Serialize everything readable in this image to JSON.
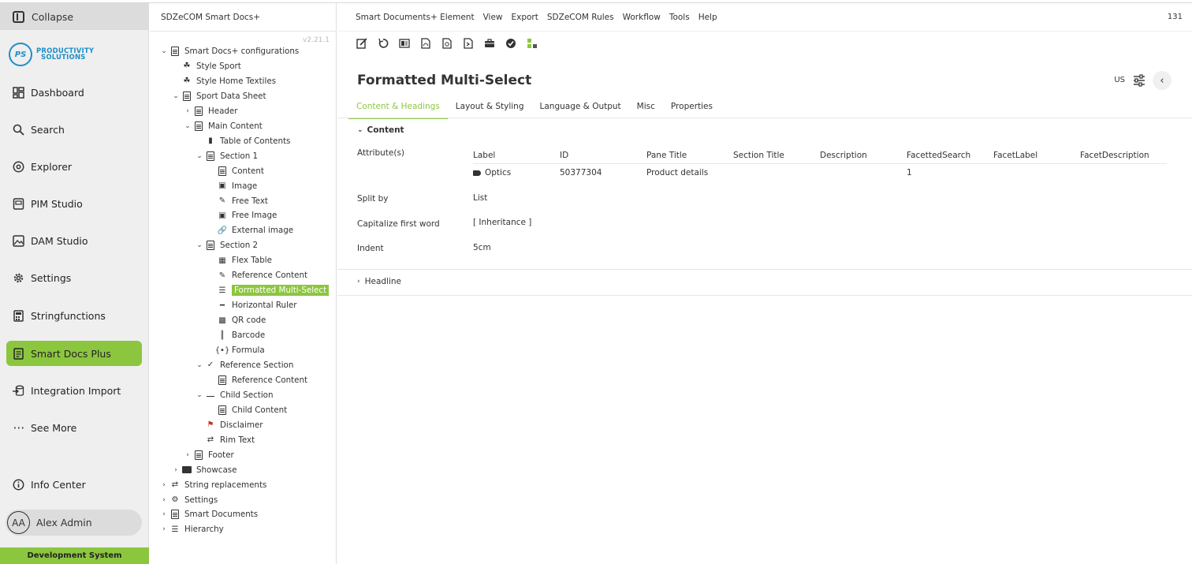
{
  "sidebar": {
    "collapse_label": "Collapse",
    "logo_initials": "PS",
    "logo_line1": "PRODUCTIVITY",
    "logo_line2": "SOLUTIONS",
    "items": [
      {
        "label": "Dashboard",
        "icon": "dashboard-icon"
      },
      {
        "label": "Search",
        "icon": "search-icon"
      },
      {
        "label": "Explorer",
        "icon": "explorer-icon"
      },
      {
        "label": "PIM Studio",
        "icon": "pim-icon"
      },
      {
        "label": "DAM Studio",
        "icon": "image-icon"
      },
      {
        "label": "Settings",
        "icon": "gear-icon"
      },
      {
        "label": "Stringfunctions",
        "icon": "calculator-icon"
      },
      {
        "label": "Smart Docs Plus",
        "icon": "docs-icon"
      },
      {
        "label": "Integration Import",
        "icon": "import-icon"
      },
      {
        "label": "See More",
        "icon": "more-icon"
      }
    ],
    "info_center": "Info Center",
    "user_initials": "AA",
    "user_name": "Alex Admin",
    "env_label": "Development System",
    "accent": "#8cc63f"
  },
  "tree": {
    "title": "SDZeCOM Smart Docs+",
    "version": "v2.21.1",
    "nodes": [
      {
        "label": "Smart Docs+ configurations",
        "chev": "v"
      },
      {
        "label": "Style Sport",
        "chev": ""
      },
      {
        "label": "Style Home Textiles",
        "chev": ""
      },
      {
        "label": "Sport Data Sheet",
        "chev": "v"
      },
      {
        "label": "Header",
        "chev": ">"
      },
      {
        "label": "Main Content",
        "chev": "v"
      },
      {
        "label": "Table of Contents",
        "chev": ""
      },
      {
        "label": "Section 1",
        "chev": "v"
      },
      {
        "label": "Content",
        "chev": ""
      },
      {
        "label": "Image",
        "chev": ""
      },
      {
        "label": "Free Text",
        "chev": ""
      },
      {
        "label": "Free Image",
        "chev": ""
      },
      {
        "label": "External image",
        "chev": ""
      },
      {
        "label": "Section 2",
        "chev": "v"
      },
      {
        "label": "Flex Table",
        "chev": ""
      },
      {
        "label": "Reference Content",
        "chev": ""
      },
      {
        "label": "Formatted Multi-Select",
        "chev": ""
      },
      {
        "label": "Horizontal Ruler",
        "chev": ""
      },
      {
        "label": "QR code",
        "chev": ""
      },
      {
        "label": "Barcode",
        "chev": ""
      },
      {
        "label": "Formula",
        "chev": ""
      },
      {
        "label": "Reference Section",
        "chev": "v"
      },
      {
        "label": "Reference Content",
        "chev": ""
      },
      {
        "label": "Child Section",
        "chev": "v"
      },
      {
        "label": "Child Content",
        "chev": ""
      },
      {
        "label": "Disclaimer",
        "chev": ""
      },
      {
        "label": "Rim Text",
        "chev": ""
      },
      {
        "label": "Footer",
        "chev": ">"
      },
      {
        "label": "Showcase",
        "chev": ">"
      },
      {
        "label": "String replacements",
        "chev": ">"
      },
      {
        "label": "Settings",
        "chev": ">"
      },
      {
        "label": "Smart Documents",
        "chev": ">"
      },
      {
        "label": "Hierarchy",
        "chev": ">"
      }
    ]
  },
  "menu": {
    "items": [
      "Smart Documents+ Element",
      "View",
      "Export",
      "SDZeCOM Rules",
      "Workflow",
      "Tools",
      "Help"
    ],
    "count": "131"
  },
  "page": {
    "title": "Formatted Multi-Select",
    "locale": "US",
    "tabs": [
      "Content & Headings",
      "Layout & Styling",
      "Language & Output",
      "Misc",
      "Properties"
    ],
    "section_title": "Content",
    "attributes_label": "Attribute(s)",
    "attr_columns": [
      "Label",
      "ID",
      "Pane Title",
      "Section Title",
      "Description",
      "FacettedSearch",
      "FacetLabel",
      "FacetDescription"
    ],
    "attr_rows": [
      {
        "label": "Optics",
        "id": "50377304",
        "pane_title": "Product details",
        "section_title": "",
        "description": "",
        "facetted_search": "1",
        "facet_label": "",
        "facet_description": ""
      }
    ],
    "split_by_label": "Split by",
    "split_by_value": "List",
    "capitalize_label": "Capitalize first word",
    "capitalize_value": "[ Inheritance ]",
    "indent_label": "Indent",
    "indent_value": "5cm",
    "headline_label": "Headline"
  }
}
